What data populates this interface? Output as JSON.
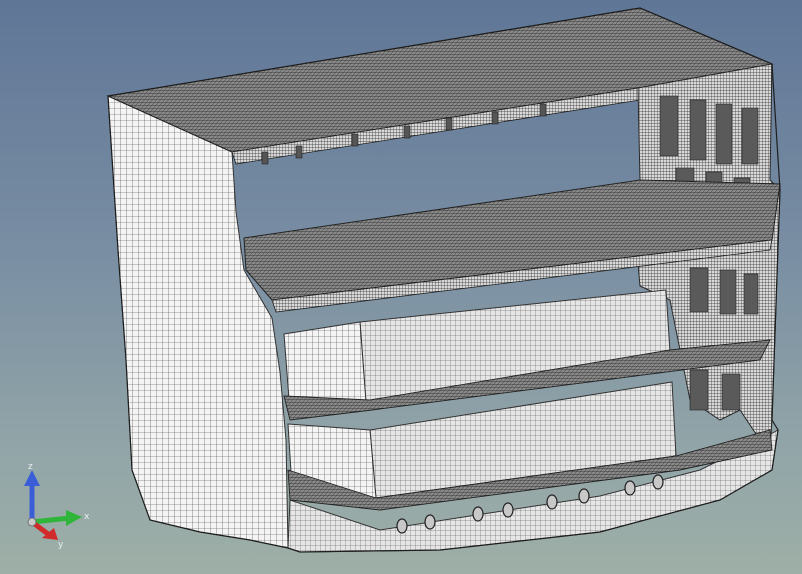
{
  "viewport": {
    "background_top": "#5f7697",
    "background_bottom": "#9dafa6"
  },
  "model": {
    "object": "ship-hull-block-fe-mesh",
    "mesh_color": "#ffffff",
    "mesh_line_color": "#3c3c3c",
    "dense_deck_color": "#4a4a4a"
  },
  "axis_triad": {
    "x_label": "x",
    "y_label": "y",
    "z_label": "z",
    "x_color": "#2fb53a",
    "y_color": "#d12a2a",
    "z_color": "#3a5ed8"
  }
}
